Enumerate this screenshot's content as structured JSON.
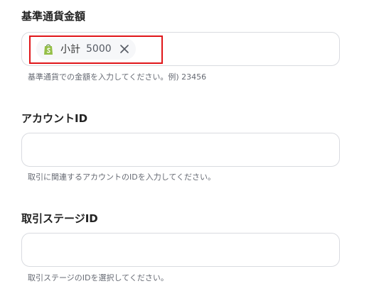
{
  "fields": [
    {
      "label": "基準通貨金額",
      "chip": {
        "icon": "shopify-bag-icon",
        "name": "小計",
        "value": "5000"
      },
      "help": "基準通貨での金額を入力してください。例) 23456"
    },
    {
      "label": "アカウントID",
      "value": "",
      "help": "取引に関連するアカウントのIDを入力してください。"
    },
    {
      "label": "取引ステージID",
      "value": "",
      "help": "取引ステージのIDを選択してください。"
    }
  ],
  "colors": {
    "highlight": "#e0161a",
    "shopify_green": "#95bf47",
    "border": "#d9dbe0"
  }
}
